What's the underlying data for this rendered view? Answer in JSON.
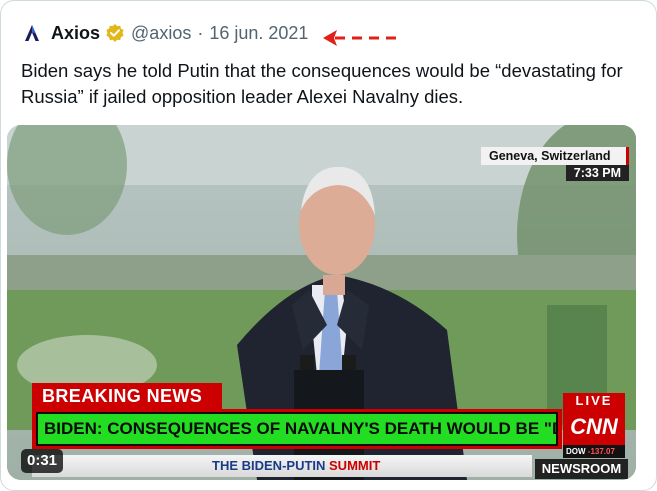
{
  "tweet": {
    "author_name": "Axios",
    "handle": "@axios",
    "separator": "·",
    "date": "16 jun. 2021",
    "text": "Biden says he told Putin that the consequences would be “devastating for Russia” if jailed opposition leader Alexei Navalny dies."
  },
  "icons": {
    "logo": "axios-logo-icon",
    "badge": "verified-gold-badge-icon",
    "annotation": "red-dashed-arrow-icon"
  },
  "colors": {
    "badge": "#e2b719",
    "annotation_arrow": "#e0201b",
    "cnn_red": "#cc0000",
    "headline_green": "#22dd22"
  },
  "video": {
    "location": "Geneva, Switzerland",
    "time": "7:33 PM",
    "breaking_label": "BREAKING NEWS",
    "headline": "BIDEN: CONSEQUENCES OF NAVALNY'S DEATH WOULD BE \"DEVASTATING\"",
    "ticker_prefix": "THE ",
    "ticker_main": "BIDEN-PUTIN ",
    "ticker_accent": "SUMMIT",
    "live_label": "LIVE",
    "network": "CNN",
    "dow_label": "DOW ",
    "dow_value": "-137.07",
    "newsroom": "NEWSROOM",
    "duration": "0:31"
  }
}
